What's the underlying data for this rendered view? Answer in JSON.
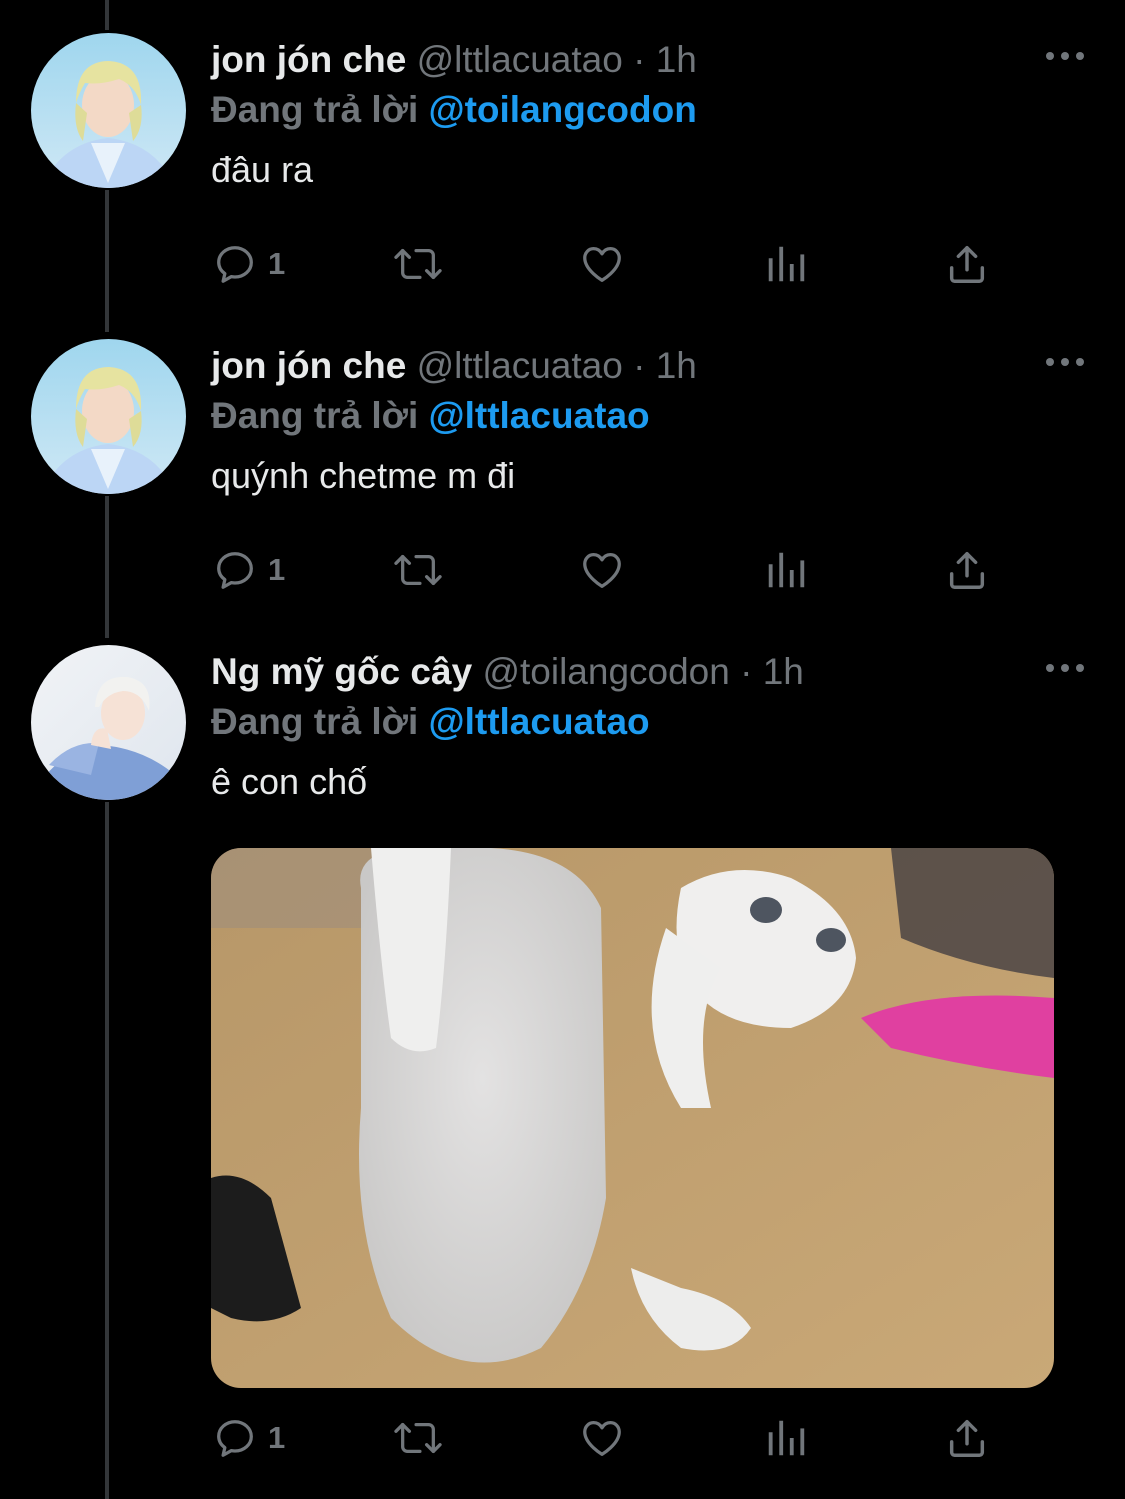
{
  "tweets": [
    {
      "display_name": "jon jón che",
      "handle": "@lttlacuatao",
      "dot": "·",
      "time": "1h",
      "reply_prefix": "Đang trả lời",
      "reply_to": "@toilangcodon",
      "text": "đâu ra",
      "reply_count": "1"
    },
    {
      "display_name": "jon jón che",
      "handle": "@lttlacuatao",
      "dot": "·",
      "time": "1h",
      "reply_prefix": "Đang trả lời",
      "reply_to": "@lttlacuatao",
      "text": "quýnh chetme m đi",
      "reply_count": "1"
    },
    {
      "display_name": "Ng mỹ gốc cây",
      "handle": "@toilangcodon",
      "dot": "·",
      "time": "1h",
      "reply_prefix": "Đang trả lời",
      "reply_to": "@lttlacuatao",
      "text": "ê con chố",
      "reply_count": "1",
      "has_media": true
    }
  ],
  "colors": {
    "background": "#000000",
    "text_primary": "#e7e9ea",
    "text_secondary": "#71767b",
    "link": "#1d9bf0",
    "thread_line": "#333639"
  },
  "icons": {
    "reply": "reply-icon",
    "retweet": "retweet-icon",
    "like": "heart-icon",
    "views": "views-icon",
    "share": "share-icon",
    "more": "more-dots-icon"
  }
}
